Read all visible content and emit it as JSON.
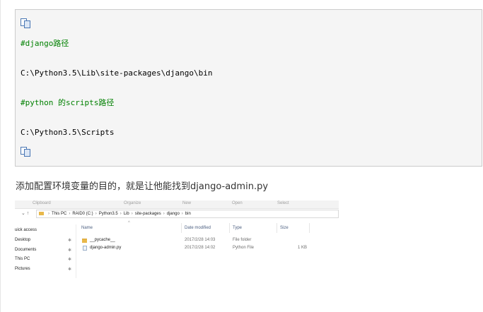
{
  "code": {
    "lines": [
      {
        "text": "#django路径",
        "kind": "comment"
      },
      {
        "text": "C:\\Python3.5\\Lib\\site-packages\\django\\bin",
        "kind": "plain"
      },
      {
        "text": "#python 的scripts路径",
        "kind": "comment"
      },
      {
        "text": "C:\\Python3.5\\Scripts",
        "kind": "plain"
      }
    ]
  },
  "paragraph": "添加配置环境变量的目的，就是让他能找到django-admin.py",
  "explorer": {
    "ribbon": [
      "Clipboard",
      "Organize",
      "New",
      "Open",
      "Select"
    ],
    "nav_arrows": "⌄  ↑",
    "breadcrumbs": [
      "This PC",
      "RAID0 (C:)",
      "Python3.5",
      "Lib",
      "site-packages",
      "django",
      "bin"
    ],
    "nav_pane": [
      {
        "label": "uick access",
        "pinned": false
      },
      {
        "label": "Desktop",
        "pinned": true
      },
      {
        "label": "Documents",
        "pinned": true
      },
      {
        "label": "This PC",
        "pinned": true
      },
      {
        "label": "Pictures",
        "pinned": true
      }
    ],
    "columns": [
      "Name",
      "Date modified",
      "Type",
      "Size"
    ],
    "files": [
      {
        "name": "__pycache__",
        "date": "2017/2/28 14:03",
        "type": "File folder",
        "size": "",
        "icon": "folder-icon"
      },
      {
        "name": "django-admin.py",
        "date": "2017/2/28 14:02",
        "type": "Python File",
        "size": "1 KB",
        "icon": "python-file-icon"
      }
    ]
  }
}
